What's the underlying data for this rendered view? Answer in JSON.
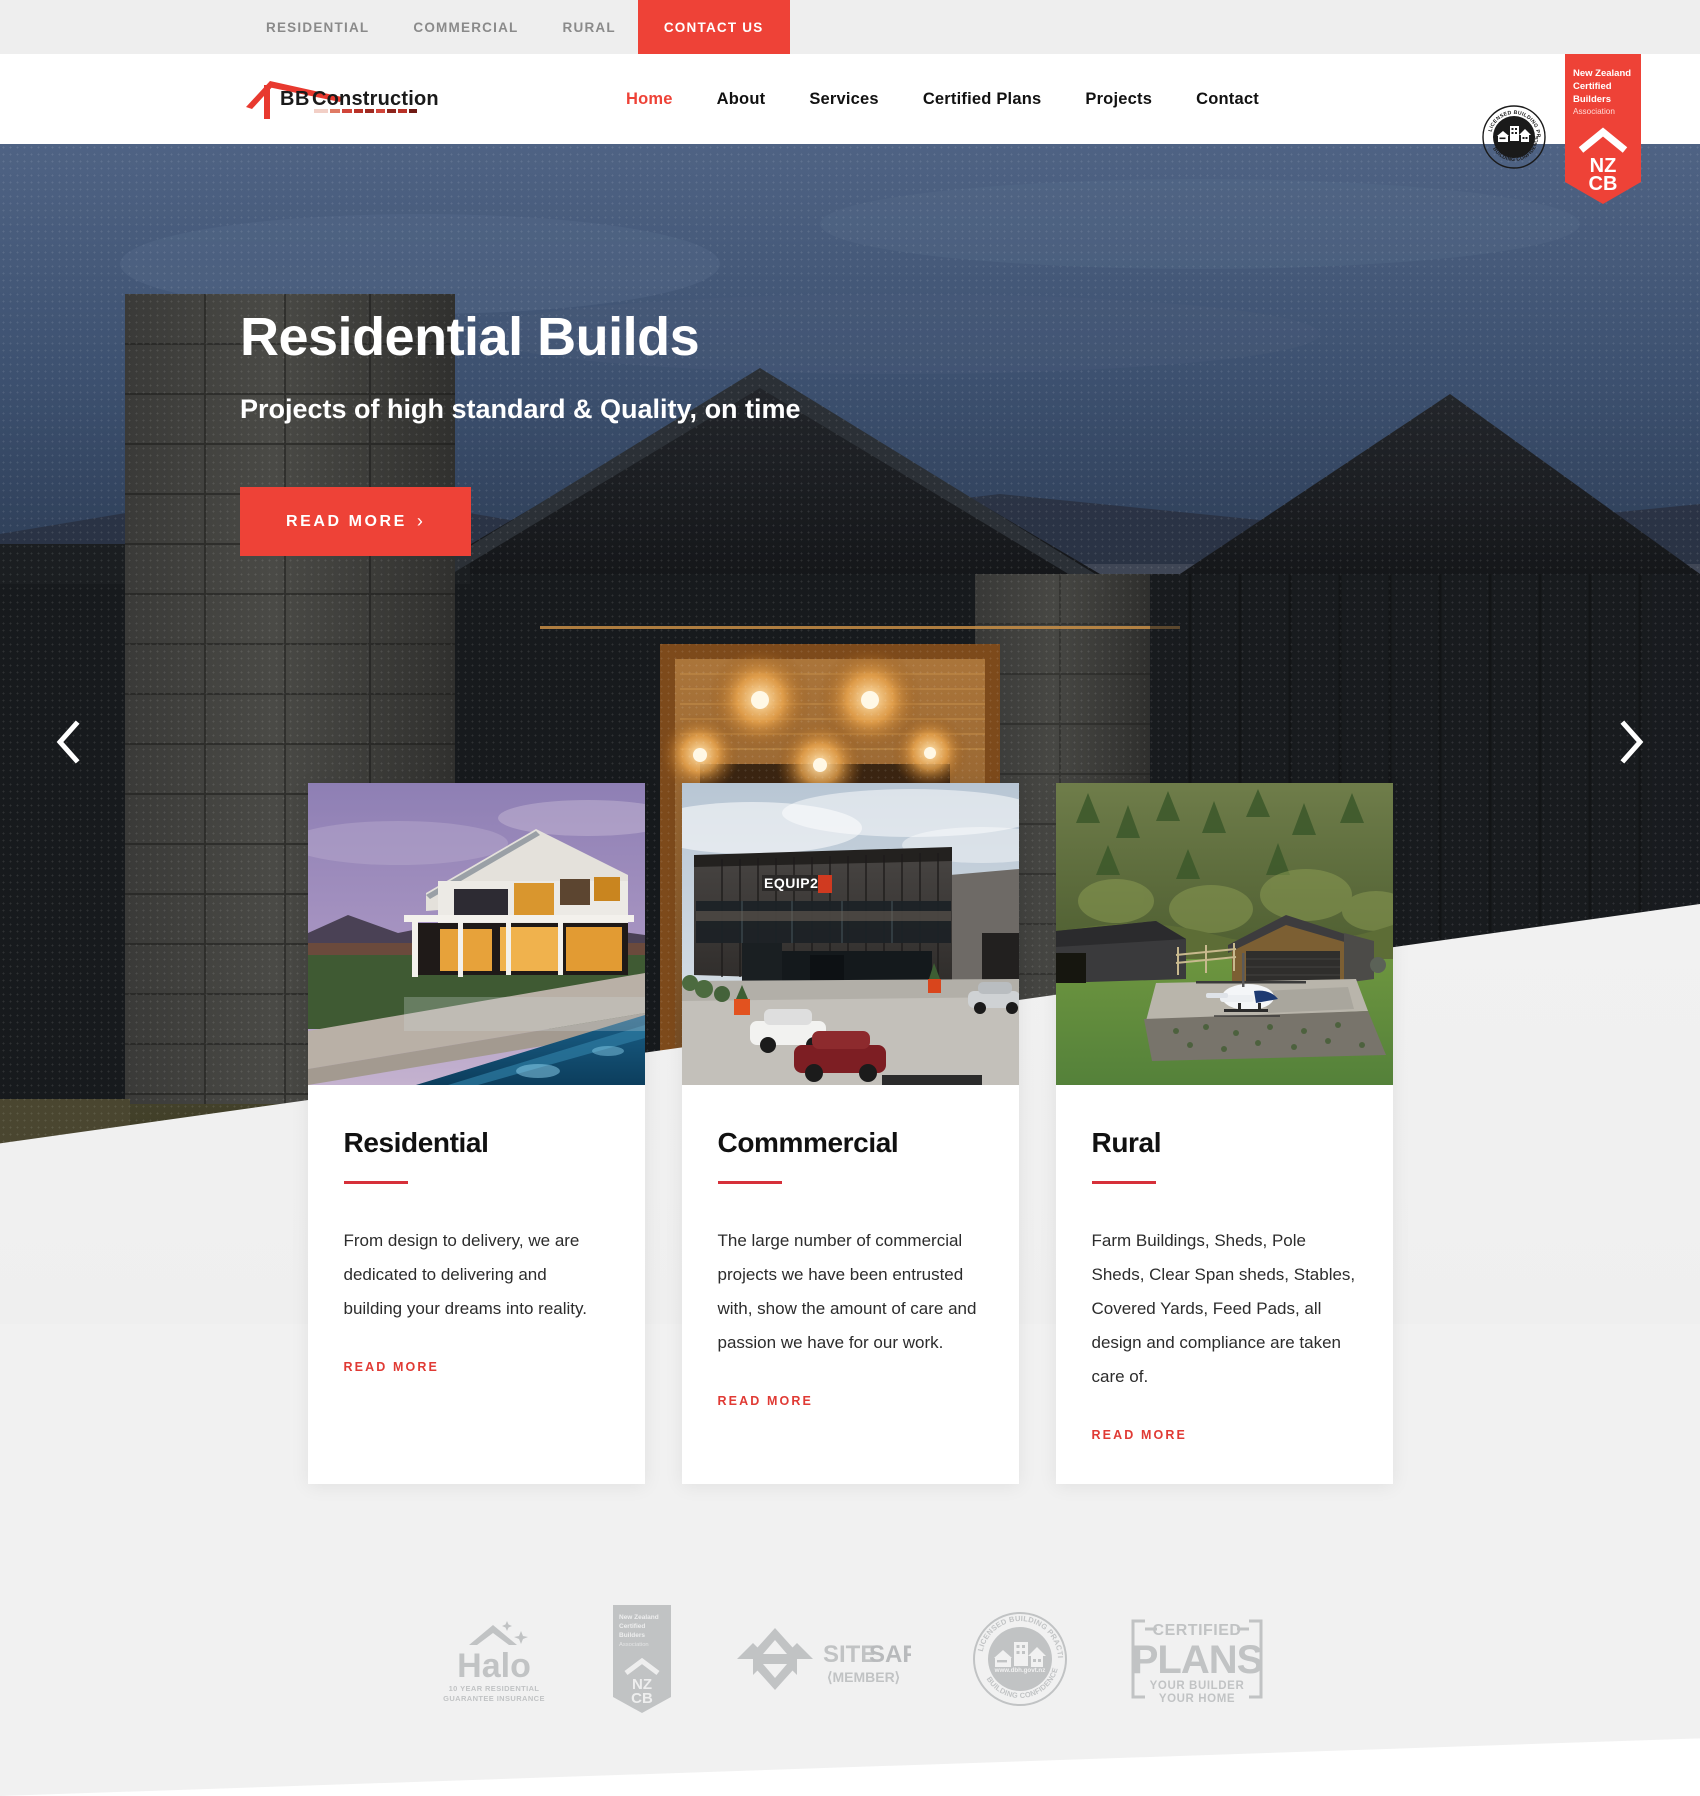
{
  "topbar": {
    "items": [
      {
        "label": "RESIDENTIAL",
        "cta": false
      },
      {
        "label": "COMMERCIAL",
        "cta": false
      },
      {
        "label": "RURAL",
        "cta": false
      },
      {
        "label": "CONTACT US",
        "cta": true
      }
    ],
    "background": "#eeeeee",
    "cta_color": "#ee4237"
  },
  "header": {
    "logo_text": "BB Construction",
    "nav": [
      {
        "label": "Home",
        "active": true
      },
      {
        "label": "About",
        "active": false
      },
      {
        "label": "Services",
        "active": false
      },
      {
        "label": "Certified Plans",
        "active": false
      },
      {
        "label": "Projects",
        "active": false
      },
      {
        "label": "Contact",
        "active": false
      }
    ],
    "badges": {
      "lbp": {
        "top_text": "LICENSED BUILDING PRACTITIONER",
        "bottom_text": "BUILDING CONFIDENCE"
      },
      "nzcb": {
        "line1": "New Zealand",
        "line2": "Certified",
        "line3": "Builders",
        "line4": "Association",
        "mark_line1": "NZ",
        "mark_line2": "CB",
        "color": "#ee4237"
      }
    }
  },
  "hero": {
    "title": "Residential Builds",
    "subtitle": "Projects of high standard & Quality, on time",
    "button_label": "READ MORE",
    "button_chevron": "›",
    "prev_icon": "chevron-left-icon",
    "next_icon": "chevron-right-icon"
  },
  "cards": [
    {
      "title": "Residential",
      "text": "From design to delivery, we are dedicated to delivering and building your dreams into reality.",
      "link_label": "READ MORE",
      "image_alt": "modern two-storey home at dusk with pool"
    },
    {
      "title": "Commmercial",
      "text": "The large number of commercial projects we have been entrusted with, show the amount of care and passion we have for our work.",
      "link_label": "READ MORE",
      "image_alt": "dark clad commercial building with EQUIP2 signage and carpark",
      "image_sign": "EQUIP2"
    },
    {
      "title": "Rural",
      "text": "Farm Buildings, Sheds, Pole Sheds, Clear Span sheds, Stables, Covered Yards, Feed Pads, all design and compliance are taken care of.",
      "link_label": "READ MORE",
      "image_alt": "rural sheds and hangar with helicopter on hillside"
    }
  ],
  "partners": [
    {
      "name": "Halo",
      "title": "Halo",
      "sub1": "10 YEAR RESIDENTIAL",
      "sub2": "GUARANTEE INSURANCE"
    },
    {
      "name": "NZCB",
      "line1": "New Zealand",
      "line2": "Certified",
      "line3": "Builders",
      "line4": "Association",
      "mark_line1": "NZ",
      "mark_line2": "CB"
    },
    {
      "name": "SiteSafe",
      "word1": "SITE",
      "word2": "SAFE",
      "member": "MEMBER"
    },
    {
      "name": "LBP",
      "top_text": "LICENSED BUILDING PRACTITIONER",
      "bottom_text": "BUILDING CONFIDENCE",
      "url": "www.dbh.govt.nz"
    },
    {
      "name": "Certified Plans",
      "line1": "CERTIFIED",
      "line2": "PLANS",
      "line3": "YOUR BUILDER",
      "line4": "YOUR HOME"
    }
  ],
  "theme": {
    "accent": "#ee4237",
    "accent_dark": "#d6303a",
    "page_bg": "#f1f1f1",
    "text": "#1d1d1d"
  }
}
